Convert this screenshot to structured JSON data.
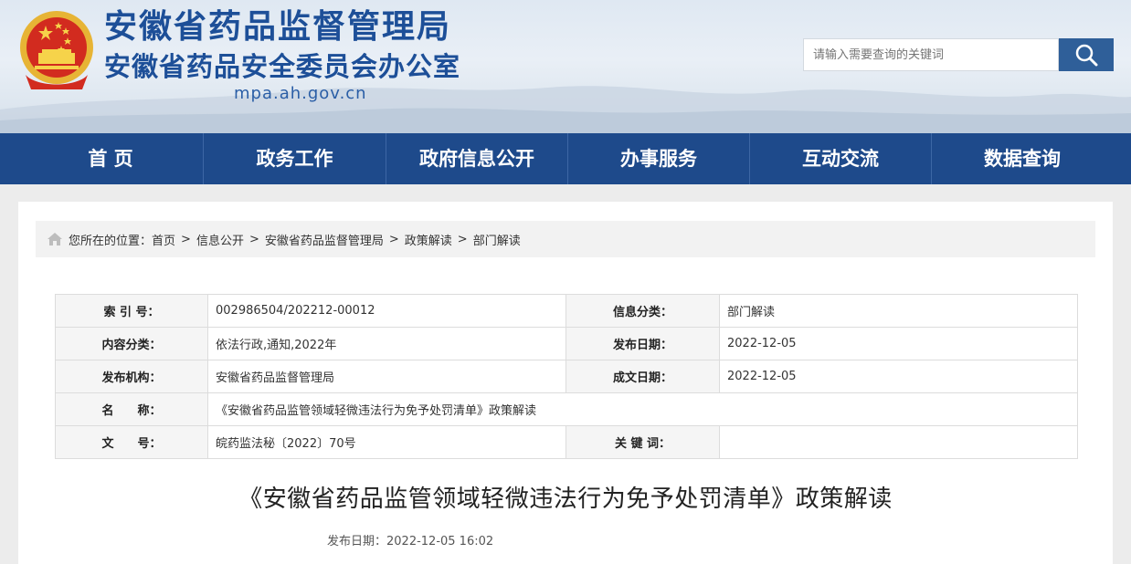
{
  "header": {
    "title": "安徽省药品监督管理局",
    "subtitle": "安徽省药品安全委员会办公室",
    "url": "mpa.ah.gov.cn",
    "emblem_icon": "national-emblem-icon"
  },
  "search": {
    "placeholder": "请输入需要查询的关键词",
    "button_icon": "search-icon"
  },
  "nav": {
    "items": [
      {
        "label": "首 页"
      },
      {
        "label": "政务工作"
      },
      {
        "label": "政府信息公开"
      },
      {
        "label": "办事服务"
      },
      {
        "label": "互动交流"
      },
      {
        "label": "数据查询"
      }
    ]
  },
  "breadcrumb": {
    "prefix": "您所在的位置：",
    "items": [
      "首页",
      "信息公开",
      "安徽省药品监督管理局",
      "政策解读",
      "部门解读"
    ],
    "separator": ">"
  },
  "info": {
    "rows": [
      {
        "l1": "索 引 号：",
        "v1": "002986504/202212-00012",
        "l2": "信息分类：",
        "v2": "部门解读"
      },
      {
        "l1": "内容分类：",
        "v1": "依法行政,通知,2022年",
        "l2": "发布日期：",
        "v2": "2022-12-05"
      },
      {
        "l1": "发布机构：",
        "v1": "安徽省药品监督管理局",
        "l2": "成文日期：",
        "v2": "2022-12-05"
      },
      {
        "l1": "名　　称：",
        "v1": "《安徽省药品监管领域轻微违法行为免予处罚清单》政策解读"
      },
      {
        "l1": "文　　号：",
        "v1": "皖药监法秘〔2022〕70号",
        "l2": "关 键 词：",
        "v2": ""
      }
    ]
  },
  "article": {
    "title": "《安徽省药品监管领域轻微违法行为免予处罚清单》政策解读",
    "publish_date": "发布日期：2022-12-05 16:02"
  },
  "colors": {
    "brand_blue": "#1d4f98",
    "nav_blue": "#1e4a8b",
    "search_button": "#2f5f99"
  }
}
